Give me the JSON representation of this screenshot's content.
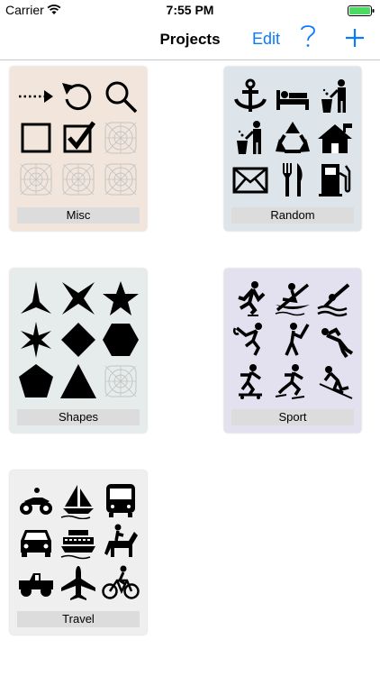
{
  "status": {
    "carrier": "Carrier",
    "time": "7:55 PM"
  },
  "nav": {
    "title": "Projects",
    "edit": "Edit"
  },
  "colors": {
    "accent": "#0a7aff",
    "battery": "#4cd964"
  },
  "projects": [
    {
      "label": "Misc",
      "bg": "#f2e6dc",
      "icons": [
        "dotted-arrow-icon",
        "undo-icon",
        "magnifier-icon",
        "empty-checkbox-icon",
        "checked-checkbox-icon",
        "blank-icon",
        "blank-icon",
        "blank-icon",
        "blank-icon"
      ]
    },
    {
      "label": "Random",
      "bg": "#dde4ea",
      "icons": [
        "anchor-icon",
        "bed-icon",
        "trash-person-icon",
        "trash-person-icon",
        "recycle-icon",
        "house-icon",
        "envelope-icon",
        "fork-knife-icon",
        "fuel-pump-icon"
      ]
    },
    {
      "label": "Shapes",
      "bg": "#e6eceb",
      "icons": [
        "star-3-icon",
        "star-4-icon",
        "star-5-icon",
        "star-6-icon",
        "diamond-icon",
        "hexagon-icon",
        "pentagon-icon",
        "triangle-icon",
        "blank-icon"
      ]
    },
    {
      "label": "Sport",
      "bg": "#e3e1ef",
      "icons": [
        "skating-icon",
        "kayak-icon",
        "diving-icon",
        "hockey-icon",
        "golf-icon",
        "scuba-icon",
        "skateboard-icon",
        "ice-skating-icon",
        "skiing-icon"
      ]
    },
    {
      "label": "Travel",
      "bg": "#efefef",
      "icons": [
        "atv-icon",
        "sailboat-icon",
        "bus-icon",
        "car-icon",
        "ferry-icon",
        "horse-riding-icon",
        "jeep-icon",
        "airplane-icon",
        "bicycle-icon"
      ]
    }
  ]
}
